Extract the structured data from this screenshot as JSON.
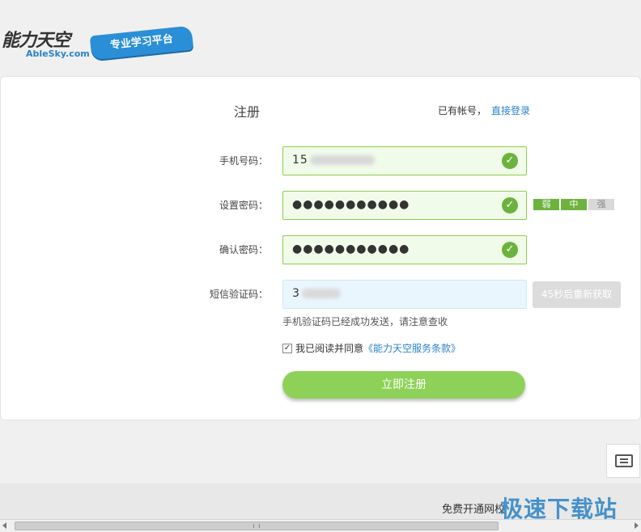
{
  "logo": {
    "cn": "能力天空",
    "en": "AbleSky.com",
    "slogan": "专业学习平台"
  },
  "form": {
    "title": "注册",
    "login_hint": "已有帐号，",
    "login_link": "直接登录",
    "phone_label": "手机号码：",
    "phone_value": "15",
    "password_label": "设置密码：",
    "password_value": "●●●●●●●●●●●",
    "confirm_label": "确认密码：",
    "confirm_value": "●●●●●●●●●●●",
    "sms_label": "短信验证码：",
    "sms_value": "3",
    "strength": {
      "weak": "弱",
      "medium": "中",
      "strong": "强"
    },
    "resend_label": "45秒后重新获取",
    "sms_tip": "手机验证码已经成功发送，请注意查收",
    "agree_text": "我已阅读并同意",
    "terms_link": "《能力天空服务条款》",
    "submit_label": "立即注册"
  },
  "footer": {
    "text": "免费开通网校",
    "watermark": "极速下载站"
  },
  "icons": {
    "check": "check-circle-icon",
    "chat": "chat-icon"
  },
  "colors": {
    "accent_green": "#6cb33e",
    "link_blue": "#2a83c6",
    "button_green": "#8ed158"
  }
}
